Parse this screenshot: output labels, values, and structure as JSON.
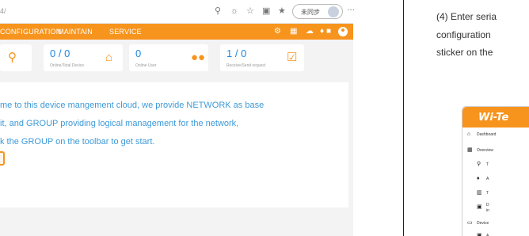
{
  "browser": {
    "address": "4/",
    "signin_label": "未同步",
    "more_label": "···"
  },
  "nav": {
    "items": [
      "CONFIGURATION",
      "MAINTAIN",
      "SERVICE"
    ]
  },
  "stats": [
    {
      "value": "",
      "label": "",
      "icon": "topology-icon"
    },
    {
      "value": "0 / 0",
      "label": "Online/Total Device",
      "icon": "router-icon"
    },
    {
      "value": "0",
      "label": "Online User",
      "icon": "users-icon"
    },
    {
      "value": "1 / 0",
      "label": "Receive/Send request",
      "icon": "task-check-icon"
    }
  ],
  "welcome": {
    "lines": [
      "me to this device mangement cloud, we provide NETWORK as base",
      "it, and GROUP providing logical management for the network,",
      "k the GROUP on the toolbar to get start."
    ]
  },
  "manual": {
    "lines": [
      "(4)  Enter seria",
      "configuration",
      "sticker on the"
    ],
    "logo": "Wi-Te",
    "menu": [
      "Dashboard",
      "Overview",
      "T",
      "A",
      "T",
      "D",
      "Device",
      "A"
    ],
    "menu_sub": "in"
  }
}
